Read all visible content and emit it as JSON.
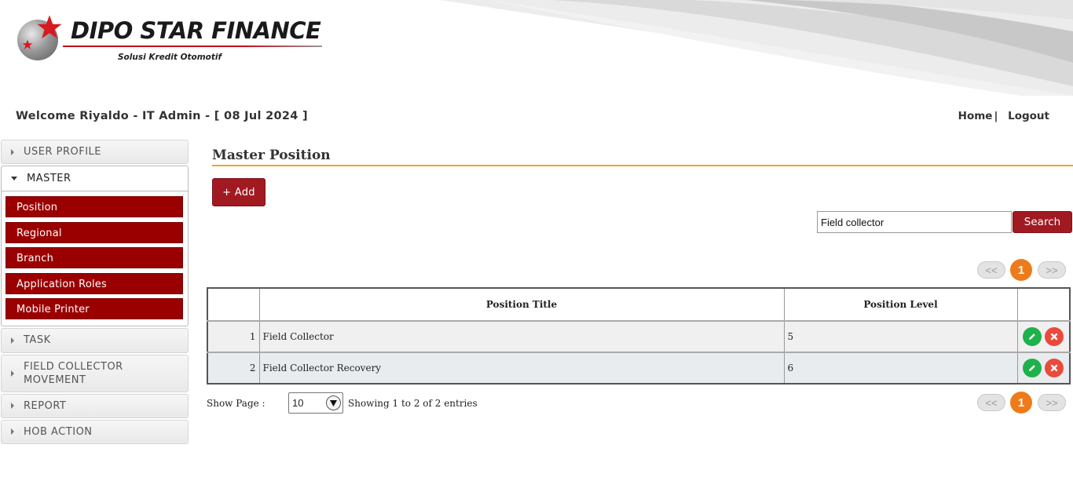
{
  "brand": {
    "name": "DIPO STAR FINANCE",
    "tagline": "Solusi Kredit Otomotif",
    "accent": "#a11a22"
  },
  "welcome_text": "Welcome Riyaldo - IT Admin - [ 08 Jul 2024 ]",
  "toplinks": {
    "home": "Home",
    "separator": "|",
    "logout": "Logout"
  },
  "sidebar": {
    "sections": [
      {
        "label": "USER PROFILE",
        "open": false
      },
      {
        "label": "MASTER",
        "open": true,
        "items": [
          "Position",
          "Regional",
          "Branch",
          "Application Roles",
          "Mobile Printer"
        ]
      },
      {
        "label": "TASK",
        "open": false
      },
      {
        "label": "FIELD COLLECTOR MOVEMENT",
        "open": false
      },
      {
        "label": "REPORT",
        "open": false
      },
      {
        "label": "HOB ACTION",
        "open": false
      }
    ],
    "submenu_color": "#9a0000"
  },
  "main": {
    "title": "Master Position",
    "add_label": "+ Add",
    "search_value": "Field collector",
    "search_label": "Search",
    "pager": {
      "prev": "<<",
      "current": "1",
      "next": ">>"
    },
    "table": {
      "columns": [
        "",
        "Position Title",
        "Position Level",
        ""
      ],
      "rows": [
        {
          "no": "1",
          "title": "Field Collector",
          "level": "5"
        },
        {
          "no": "2",
          "title": "Field Collector Recovery",
          "level": "6"
        }
      ]
    },
    "show_page_label": "Show Page :",
    "page_size": "10",
    "entries_text": "Showing 1 to 2 of 2 entries"
  }
}
